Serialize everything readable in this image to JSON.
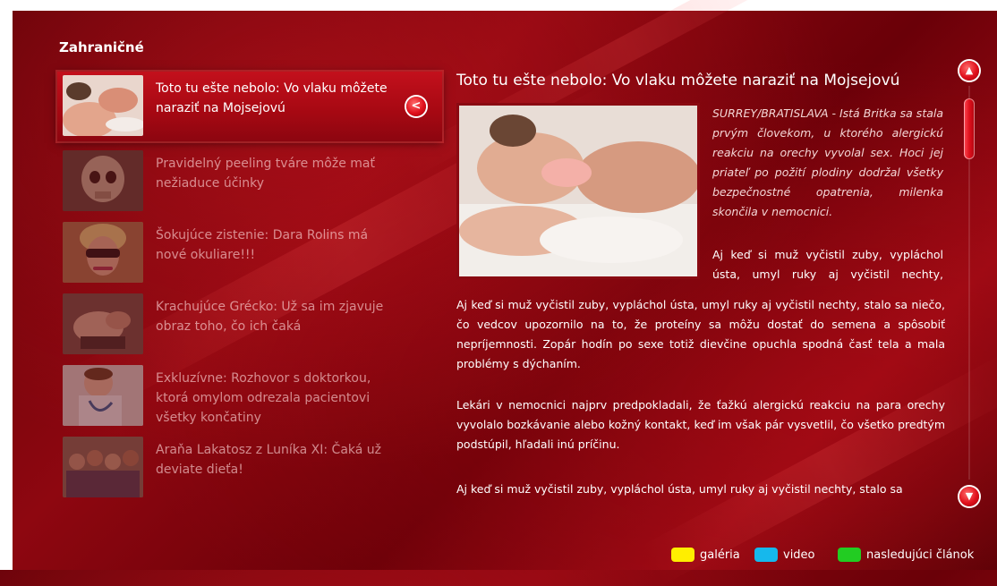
{
  "section_title": "Zahraničné",
  "back_button_glyph": "<",
  "articles": [
    {
      "title": "Toto tu ešte nebolo: Vo vlaku môžete naraziť na Mojsejovú",
      "thumbnail": "photo-couple",
      "active": true
    },
    {
      "title": "Pravidelný peeling tváre môže mať nežiaduce účinky",
      "thumbnail": "photo-skull",
      "active": false
    },
    {
      "title": "Šokujúce zistenie: Dara Rolins má nové okuliare!!!",
      "thumbnail": "photo-sunglasses-woman",
      "active": false
    },
    {
      "title": "Krachujúce Grécko: Už sa im zjavuje obraz toho, čo ich čaká",
      "thumbnail": "photo-hands",
      "active": false
    },
    {
      "title": "Exkluzívne: Rozhovor s doktorkou, ktorá omylom odrezala pacientovi všetky končatiny",
      "thumbnail": "photo-doctor",
      "active": false
    },
    {
      "title": "Araňa Lakatosz z Luníka XI: Čaká už deviate dieťa!",
      "thumbnail": "photo-crowd",
      "active": false
    }
  ],
  "article": {
    "title": "Toto tu ešte nebolo: Vo vlaku môžete naraziť na Mojsejovú",
    "lead": "SURREY/BRATISLAVA - Istá Britka sa stala prvým človekom, u ktorého alergickú reakciu na orechy vyvolal sex. Hoci jej priateľ po požití plodiny dodržal všetky bezpečnostné opatrenia, milenka skončila v nemocnici.",
    "beside_text": "Aj keď si muž vyčistil zuby, vypláchol ústa, umyl ruky aj vyčistil nechty,",
    "paragraph_1": "Aj keď si muž vyčistil zuby, vypláchol ústa, umyl ruky aj vyčistil nechty, stalo sa niečo, čo vedcov upozornilo na to, že proteíny sa môžu dostať do semena a spôsobiť nepríjemnosti. Zopár hodín po sexe totiž dievčine opuchla spodná časť tela a mala problémy s dýchaním.",
    "paragraph_2": "Lekári v nemocnici najprv predpokladali, že ťažkú alergickú reakciu na para orechy vyvolalo bozkávanie alebo kožný kontakt, keď im však pár vysvetlil, čo všetko predtým podstúpil, hľadali inú príčinu.",
    "paragraph_3": "Aj keď si muž vyčistil zuby, vypláchol ústa, umyl ruky aj vyčistil nechty, stalo sa"
  },
  "scroll": {
    "up_glyph": "▲",
    "down_glyph": "▼"
  },
  "legend": [
    {
      "label": "galéria",
      "color": "#ffee00"
    },
    {
      "label": "video",
      "color": "#16b8ec"
    },
    {
      "label": "nasledujúci článok",
      "color": "#22cc22"
    }
  ],
  "colors": {
    "background": "#8e0710",
    "accent": "#e0101c",
    "active_item": "#c3101c"
  }
}
